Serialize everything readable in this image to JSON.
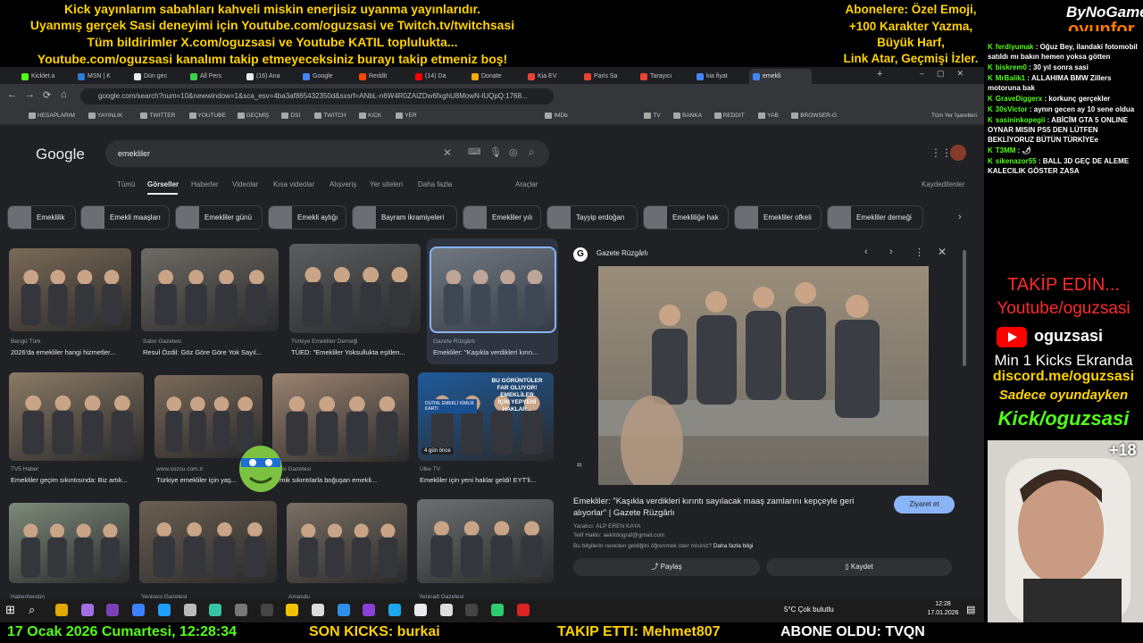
{
  "overlay": {
    "lines_left": [
      "Kick yayınlarım sabahları kahveli miskin enerjisiz uyanma yayınlarıdır.",
      "Uyanmış gerçek Sasi deneyimi için Youtube.com/oguzsasi ve Twitch.tv/twitchsasi",
      "Tüm bildirimler X.com/oguzsasi ve Youtube KATIL toplulukta...",
      "Youtube.com/oguzsasi kanalımı takip etmeyeceksiniz burayı takip etmeniz boş!"
    ],
    "lines_right": [
      "Abonelere: Özel Emoji,",
      "+100 Karakter Yazma,",
      "Büyük Harf,",
      "Link Atar, Geçmişi İzler."
    ],
    "brand_top": "ByNoGame",
    "brand_bottom": "oyunfor",
    "follow_title": "TAKİP EDİN...",
    "follow_youtube": "Youtube/oguzsasi",
    "yt_name": "oguzsasi",
    "min_kicks": "Min 1 Kicks Ekranda",
    "discord": "discord.me/oguzsasi",
    "only_game": "Sadece oyundayken",
    "kick_channel": "Kick/oguzsasi",
    "age_badge": "+18",
    "colors": {
      "yellow": "#ffd200",
      "kick_green": "#53fc18",
      "red": "#ff2a2a"
    }
  },
  "chat": [
    {
      "user": "ferdiyumak",
      "text": "Oğuz Bey, ilandaki fotomobil satıldı mı bakın hemen yoksa götten"
    },
    {
      "user": "biskrem0",
      "text": "30 yıl sonra sasi"
    },
    {
      "user": "MrBalik1",
      "text": "ALLAHIMA BMW Zillers motoruna bak"
    },
    {
      "user": "GraveDiggerx",
      "text": "korkunç gerçekler"
    },
    {
      "user": "30sVictor",
      "text": "aynın gecen ay 10 sene oldua"
    },
    {
      "user": "sasininkopegii",
      "text": "ABİCİM GTA 5 ONLINE OYNAR MISIN PS5 DEN LÜTFEN BEKLİYORUZ BÜTÜN TÜRKİYEe"
    },
    {
      "user": "T3MM",
      "text": "🌶"
    },
    {
      "user": "sikenazor55",
      "text": "BALL 3D GEÇ DE ALEME KALECILIK GÖSTER ZASA"
    }
  ],
  "browser": {
    "tabs": [
      {
        "label": "Kicklet.a",
        "color": "#53fc18"
      },
      {
        "label": "MSN | K",
        "color": "#2b7cd3"
      },
      {
        "label": "Dün gec",
        "color": "#e8eaed"
      },
      {
        "label": "All Pers",
        "color": "#3ccf4e"
      },
      {
        "label": "(16) Ana",
        "color": "#e8eaed"
      },
      {
        "label": "Google",
        "color": "#4285f4"
      },
      {
        "label": "Reddit",
        "color": "#ff4500"
      },
      {
        "label": "(14) Da",
        "color": "#ff0000"
      },
      {
        "label": "Donate",
        "color": "#f2a900"
      },
      {
        "label": "Kia EV",
        "color": "#ea4335"
      },
      {
        "label": "Paris Sa",
        "color": "#ea4335"
      },
      {
        "label": "Tarayıcı",
        "color": "#ea4335"
      },
      {
        "label": "kia fiyat",
        "color": "#4285f4"
      },
      {
        "label": "emekli",
        "color": "#4285f4"
      }
    ],
    "url": "google.com/search?num=10&newwindow=1&sca_esv=4ba3af865432350d&sxsrf=ANbL-n6W4R0ZAlZDw6fxghU8MowN-lUQpQ:1768...",
    "bookmarks": [
      "HESAPLARIM",
      "YAYINLIK",
      "TWITTER",
      "YOUTUBE",
      "GEÇMİŞ",
      "DSİ",
      "TWITCH",
      "KICK",
      "YER",
      "IMDb",
      "TV",
      "BANKA",
      "REDDIT",
      "YAB",
      "BROWSER-G"
    ],
    "bookmarks_other": "Tüm Yer İşaretleri"
  },
  "google": {
    "logo": "Google",
    "query": "emekliler",
    "tabs": [
      "Tümü",
      "Görseller",
      "Haberler",
      "Videolar",
      "Kısa videolar",
      "Alışveriş",
      "Yer siteleri",
      "Daha fazla"
    ],
    "active_tab": "Görseller",
    "tools": "Araçlar",
    "saved": "Kaydedilenler",
    "chips": [
      "Emeklilik",
      "Emekli maaşları",
      "Emekliler günü",
      "Emekli aylığı",
      "Bayram ikramiyeleri",
      "Emekliler yılı",
      "Tayyip erdoğan",
      "Emekliliğe hak",
      "Emekliler ofkeli",
      "Emekliler derneği"
    ],
    "results": [
      {
        "source": "Bengü Türk",
        "caption": "2026'da emekliler hangi hizmetler..."
      },
      {
        "source": "Sabır Gazetesi",
        "caption": "Resul Özdil: Göz Göre Göre Yok Sayıl..."
      },
      {
        "source": "Türkiye Emekliler Derneği",
        "caption": "TÜED: \"Emekliler Yoksullukta eşitlen..."
      },
      {
        "source": "Gazete Rüzgârlı",
        "caption": "Emekliler: \"Kaşıkla verdikleri kırın..."
      },
      {
        "source": "TV5 Haber",
        "caption": "Emekliler geçim sıkıntısında: Biz artık..."
      },
      {
        "source": "www.sozcu.com.tr",
        "caption": "Türkiye emekliler için yaş..."
      },
      {
        "source": "...esi Gazetesi",
        "caption": "...mik sıkıntılarla boğuşan emekli..."
      },
      {
        "source": "Ülke TV",
        "caption": "Emekliler için yeni haklar geldi! EYT'li..."
      },
      {
        "source": "Haberhergün",
        "caption": ""
      },
      {
        "source": "Yenisesi Gazetesi",
        "caption": ""
      },
      {
        "source": "Amasdu",
        "caption": ""
      },
      {
        "source": "Yeniçağ Gazetesi",
        "caption": ""
      }
    ],
    "news_badge": "4 gün önce",
    "card_text_1": "BU GÖRÜNTÜLER",
    "card_text_2": "FAR OLUYOR!",
    "card_text_3": "EMEKLİLER",
    "card_text_4": "İÇİN YEPYENİ",
    "card_text_5": "HAKLAR...",
    "card_id_text": "DİJİTAL EMEKLİ KİMLİK KARTI",
    "panel": {
      "source": "Gazete Rüzgârlı",
      "title": "Emekliler: \"Kaşıkla verdikleri kırıntı sayılacak maaş zamlarını kepçeyle geri alıyorlar\" | Gazete Rüzgârlı",
      "visit": "Ziyaret et",
      "author": "Yaratıcı: ALP EREN KAYA",
      "copyright": "Telif Hakkı: aekfotograf@gmail.com",
      "learn": "Bu bilgilerin nereden geldiğini öğrenmek ister misiniz?",
      "learn_link": "Daha fazla bilgi",
      "share": "Paylaş",
      "save": "Kaydet"
    }
  },
  "taskbar": {
    "weather": "5°C  Çok bulutlu",
    "time": "12:28",
    "date": "17.01.2026"
  },
  "ticker": {
    "datetime": "17 Ocak 2026 Cumartesi, 12:28:34",
    "last_kicks": "SON KICKS: burkai",
    "followed": "TAKIP ETTI: Mehmet807",
    "subscribed": "ABONE OLDU: TVQN"
  }
}
